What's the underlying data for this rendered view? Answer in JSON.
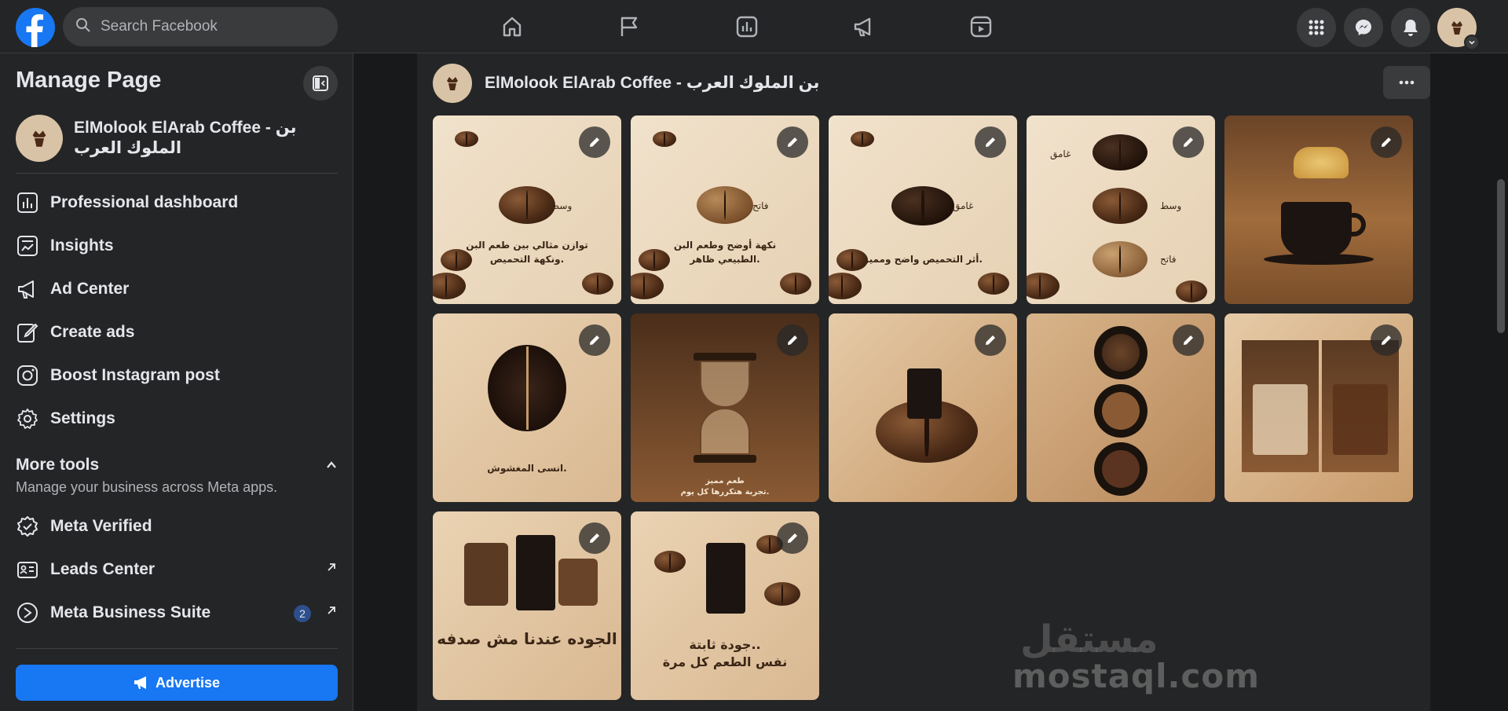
{
  "topbar": {
    "search_placeholder": "Search Facebook",
    "nav": [
      "home-icon",
      "flag-icon",
      "dashboard-icon",
      "megaphone-icon",
      "reels-icon"
    ]
  },
  "sidebar": {
    "title": "Manage Page",
    "page_name": "ElMolook ElArab Coffee - بن الملوك العرب",
    "items": [
      {
        "label": "Professional dashboard",
        "icon": "dashboard-icon"
      },
      {
        "label": "Insights",
        "icon": "insights-icon"
      },
      {
        "label": "Ad Center",
        "icon": "megaphone-icon"
      },
      {
        "label": "Create ads",
        "icon": "edit-icon"
      },
      {
        "label": "Boost Instagram post",
        "icon": "instagram-icon"
      },
      {
        "label": "Settings",
        "icon": "gear-icon"
      }
    ],
    "more_tools": {
      "title": "More tools",
      "subtitle": "Manage your business across Meta apps."
    },
    "tools": [
      {
        "label": "Meta Verified",
        "icon": "verified-icon"
      },
      {
        "label": "Leads Center",
        "icon": "leads-icon"
      },
      {
        "label": "Meta Business Suite",
        "icon": "business-suite-icon",
        "count": "2"
      }
    ],
    "advertise_label": "Advertise"
  },
  "main": {
    "page_name": "ElMolook ElArab Coffee - بن الملوك العرب",
    "tiles": [
      {
        "text1": "وسط",
        "text2": "توازن مثالي بين طعم البن",
        "text3": "ونكهة التحميص."
      },
      {
        "text1": "فاتح",
        "text2": "نكهة أوضح وطعم البن",
        "text3": "الطبيعي ظاهر."
      },
      {
        "text1": "غامق",
        "text2": "أثر التحميص واضح ومميز.",
        "text3": ""
      },
      {
        "text1": "غامق",
        "text2": "وسط",
        "text3": "فاتح"
      },
      {
        "text1": "",
        "text2": "",
        "text3": ""
      },
      {
        "text1": "انسى المغشوش.",
        "text2": "",
        "text3": ""
      },
      {
        "text1": "طعم مميز",
        "text2": "تجربة هتكررها كل يوم.",
        "text3": ""
      },
      {
        "text1": "",
        "text2": "",
        "text3": ""
      },
      {
        "text1": "",
        "text2": "",
        "text3": ""
      },
      {
        "text1": "",
        "text2": "",
        "text3": ""
      },
      {
        "text1": "الجوده عندنا مش صدفه",
        "text2": "",
        "text3": ""
      },
      {
        "text1": "جودة ثابتة..",
        "text2": "نفس الطعم كل مرة",
        "text3": ""
      }
    ],
    "watermark": "mostaql.com",
    "watermark_ar": "مستقل"
  },
  "colors": {
    "accent": "#1877f2",
    "background": "#18191a",
    "surface": "#242526",
    "tile_bg": "#e8d6bc"
  }
}
